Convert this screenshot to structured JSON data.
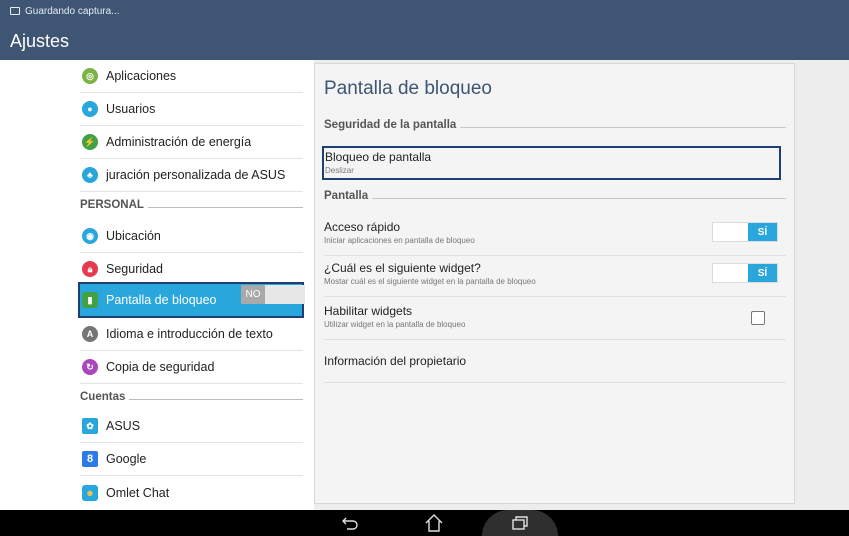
{
  "status_bar": {
    "notification": "Guardando captura..."
  },
  "app_title": "Ajustes",
  "sidebar": {
    "items": [
      {
        "label": "Aplicaciones",
        "icon": "apps-icon",
        "color": "#7cb342"
      },
      {
        "label": "Usuarios",
        "icon": "user-icon",
        "color": "#29a6dc"
      },
      {
        "label": "Administración de energía",
        "icon": "power-icon",
        "color": "#43a047"
      },
      {
        "label": "juración personalizada de ASUS",
        "icon": "asus-custom-icon",
        "color": "#29a6dc"
      }
    ],
    "personal_header": "PERSONAL",
    "personal_items": [
      {
        "label": "Ubicación",
        "icon": "location-icon",
        "color": "#29a6dc",
        "toggle": "NO"
      },
      {
        "label": "Seguridad",
        "icon": "lock-icon",
        "color": "#e53950"
      },
      {
        "label": "Pantalla de bloqueo",
        "icon": "lockscreen-icon",
        "color": "#43a047",
        "selected": true
      },
      {
        "label": "Idioma e introducción de texto",
        "icon": "language-icon",
        "color": "#757575"
      },
      {
        "label": "Copia de seguridad",
        "icon": "backup-icon",
        "color": "#ab47bc"
      }
    ],
    "accounts_header": "Cuentas",
    "accounts": [
      {
        "label": "ASUS",
        "icon": "asus-account-icon",
        "color": "#29a6dc"
      },
      {
        "label": "Google",
        "icon": "google-icon",
        "color": "#2d7be5"
      },
      {
        "label": "Omlet Chat",
        "icon": "omlet-icon",
        "color": "#29a6dc"
      }
    ]
  },
  "detail": {
    "title": "Pantalla de bloqueo",
    "security_header": "Seguridad de la pantalla",
    "screen_lock": {
      "title": "Bloqueo de pantalla",
      "summary": "Deslizar"
    },
    "display_header": "Pantalla",
    "prefs": [
      {
        "title": "Acceso rápido",
        "summary": "Iniciar aplicaciones en pantalla de bloqueo",
        "switch": "SÍ"
      },
      {
        "title": "¿Cuál es el siguiente widget?",
        "summary": "Mostar cuál es el siguiente widget en la pantalla de bloqueo",
        "switch": "SÍ"
      },
      {
        "title": "Habilitar widgets",
        "summary": "Utilizar widget en la pantalla de bloqueo",
        "checked": false
      },
      {
        "title": "Información del propietario"
      }
    ]
  },
  "accent_color": "#29a6dc",
  "toolbar_color": "#3e5573"
}
